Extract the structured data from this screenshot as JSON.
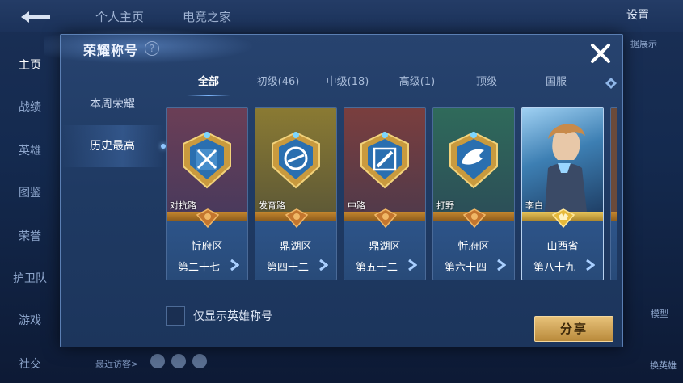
{
  "background": {
    "top_tabs": [
      "个人主页",
      "电竞之家"
    ],
    "settings_label": "设置",
    "side_nav": [
      "主页",
      "战绩",
      "英雄",
      "图鉴",
      "荣誉",
      "护卫队",
      "游戏",
      "社交"
    ],
    "right_texts": {
      "top": "据展示",
      "model": "模型",
      "switch_hero": "换英雄"
    },
    "visitors_label": "最近访客>"
  },
  "dialog": {
    "title": "荣耀称号",
    "help": "?",
    "left_menu": [
      {
        "label": "本周荣耀",
        "active": false
      },
      {
        "label": "历史最高",
        "active": true
      }
    ],
    "tabs": [
      {
        "label": "全部",
        "active": true
      },
      {
        "label": "初级(46)",
        "active": false
      },
      {
        "label": "中级(18)",
        "active": false
      },
      {
        "label": "高级(1)",
        "active": false
      },
      {
        "label": "顶级",
        "active": false
      },
      {
        "label": "国服",
        "active": false
      }
    ],
    "cards": [
      {
        "role": "对抗路",
        "area": "忻府区",
        "rank": "第二十七",
        "color_top": "#6b3e56",
        "color_bottom": "#3e3c62",
        "icon": "sword-emblem-icon"
      },
      {
        "role": "发育路",
        "area": "鼎湖区",
        "rank": "第四十二",
        "color_top": "#8a7a33",
        "color_bottom": "#5f5a36",
        "icon": "target-emblem-icon"
      },
      {
        "role": "中路",
        "area": "鼎湖区",
        "rank": "第五十二",
        "color_top": "#7a3e3e",
        "color_bottom": "#523a4a",
        "icon": "staff-emblem-icon"
      },
      {
        "role": "打野",
        "area": "忻府区",
        "rank": "第六十四",
        "color_top": "#2f6a5a",
        "color_bottom": "#2c4f58",
        "icon": "wolf-emblem-icon"
      },
      {
        "role": "李白",
        "area": "山西省",
        "rank": "第八十九",
        "color_top": "#3d7fb3",
        "color_bottom": "#2c5a86",
        "icon": "hero-portrait-icon"
      }
    ],
    "checkbox_label": "仅显示英雄称号",
    "share_label": "分享"
  }
}
